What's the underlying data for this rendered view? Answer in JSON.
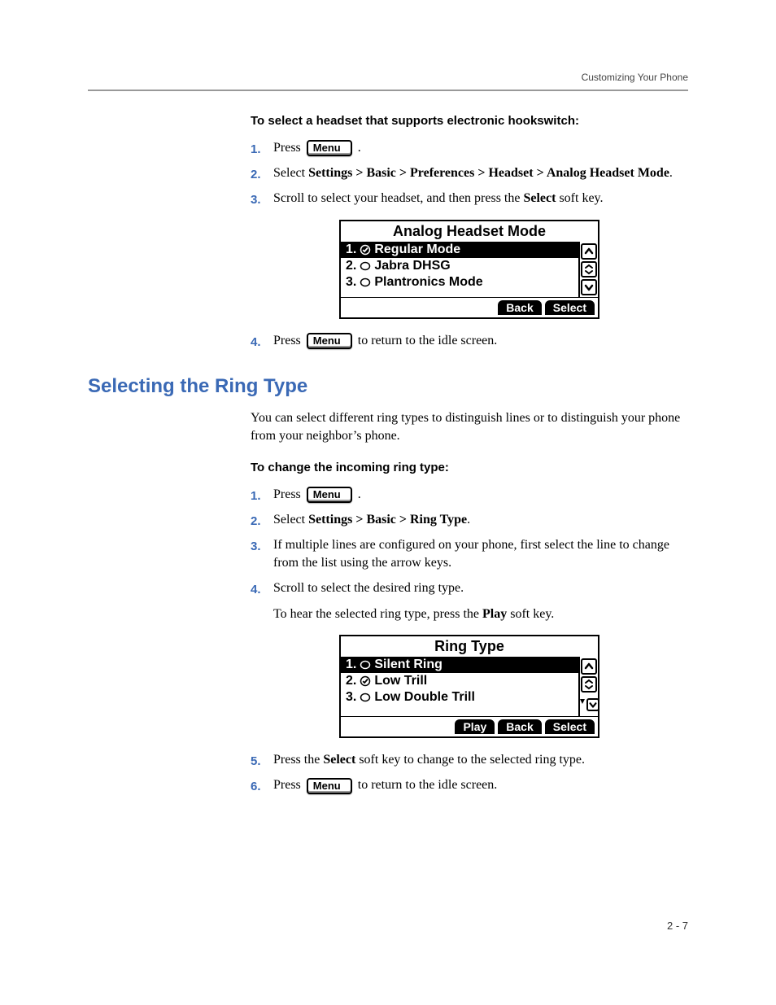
{
  "running_header": "Customizing Your Phone",
  "section_a": {
    "subheading": "To select a headset that supports electronic hookswitch:",
    "steps": [
      {
        "num": "1.",
        "press_prefix": "Press ",
        "press_button": "Menu",
        "press_suffix": " ."
      },
      {
        "num": "2.",
        "text_before": "Select ",
        "bold_path": "Settings > Basic > Preferences > Headset > Analog Headset Mode",
        "text_after": "."
      },
      {
        "num": "3.",
        "text_before": "Scroll to select your headset, and then press the ",
        "bold_word": "Select",
        "text_after": " soft key."
      },
      {
        "num": "4.",
        "press_prefix": "Press ",
        "press_button": "Menu",
        "press_suffix": " to return to the idle screen."
      }
    ],
    "lcd": {
      "title": "Analog Headset Mode",
      "items": [
        {
          "idx": "1.",
          "selected": true,
          "checked": true,
          "label": "Regular Mode"
        },
        {
          "idx": "2.",
          "selected": false,
          "checked": false,
          "label": "Jabra DHSG"
        },
        {
          "idx": "3.",
          "selected": false,
          "checked": false,
          "label": "Plantronics Mode"
        }
      ],
      "scroll_down_indicator": false,
      "softkeys": [
        "Back",
        "Select"
      ]
    }
  },
  "section_b": {
    "heading": "Selecting the Ring Type",
    "intro": "You can select different ring types to distinguish lines or to distinguish your phone from your neighbor’s phone.",
    "subheading": "To change the incoming ring type:",
    "steps": [
      {
        "num": "1.",
        "press_prefix": "Press ",
        "press_button": "Menu",
        "press_suffix": " ."
      },
      {
        "num": "2.",
        "text_before": "Select ",
        "bold_path": "Settings > Basic > Ring Type",
        "text_after": "."
      },
      {
        "num": "3.",
        "text": "If multiple lines are configured on your phone, first select the line to change from the list using the arrow keys."
      },
      {
        "num": "4.",
        "text": "Scroll to select the desired ring type.",
        "extra_before": "To hear the selected ring type, press the ",
        "extra_bold": "Play",
        "extra_after": " soft key."
      },
      {
        "num": "5.",
        "text_before": "Press the ",
        "bold_word": "Select",
        "text_after": " soft key to change to the selected ring type."
      },
      {
        "num": "6.",
        "press_prefix": "Press ",
        "press_button": "Menu",
        "press_suffix": " to return to the idle screen."
      }
    ],
    "lcd": {
      "title": "Ring Type",
      "items": [
        {
          "idx": "1.",
          "selected": true,
          "checked": false,
          "label": "Silent Ring"
        },
        {
          "idx": "2.",
          "selected": false,
          "checked": true,
          "label": "Low Trill"
        },
        {
          "idx": "3.",
          "selected": false,
          "checked": false,
          "label": "Low Double Trill"
        }
      ],
      "scroll_down_indicator": true,
      "softkeys": [
        "Play",
        "Back",
        "Select"
      ]
    }
  },
  "page_number": "2 - 7"
}
